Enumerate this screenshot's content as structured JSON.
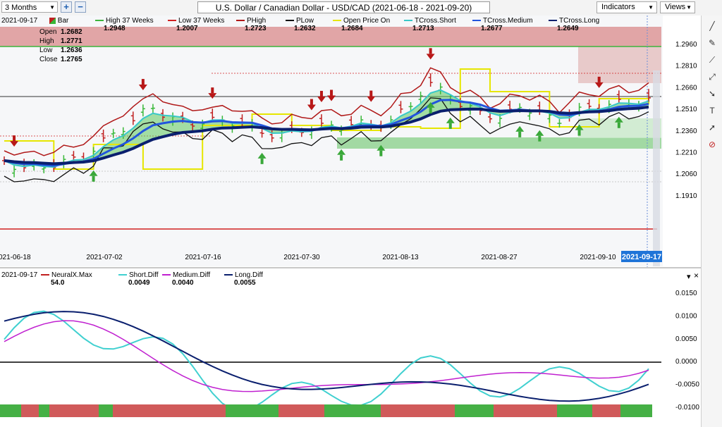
{
  "toolbar": {
    "period": "3 Months",
    "zoom_in": "+",
    "zoom_out": "−",
    "title": "U.S. Dollar / Canadian Dollar - USD/CAD (2021-06-18 - 2021-09-20)",
    "indicators_label": "Indicators",
    "views_label": "Views"
  },
  "price_legend": {
    "date": "2021-09-17",
    "bar_label": "Bar",
    "ohlc": [
      {
        "label": "Open",
        "value": "1.2682"
      },
      {
        "label": "High",
        "value": "1.2771"
      },
      {
        "label": "Low",
        "value": "1.2636"
      },
      {
        "label": "Close",
        "value": "1.2765"
      }
    ],
    "items": [
      {
        "label": "High 37 Weeks",
        "value": "1.2948",
        "color": "#3cb43c"
      },
      {
        "label": "Low 37 Weeks",
        "value": "1.2007",
        "color": "#d02020"
      },
      {
        "label": "PHigh",
        "value": "1.2723",
        "color": "#b01818"
      },
      {
        "label": "PLow",
        "value": "1.2632",
        "color": "#101010"
      },
      {
        "label": "Open Price On",
        "value": "1.2684",
        "color": "#e6e600"
      },
      {
        "label": "TCross.Short",
        "value": "1.2713",
        "color": "#38c8c8"
      },
      {
        "label": "TCross.Medium",
        "value": "1.2677",
        "color": "#2255dd"
      },
      {
        "label": "TCross.Long",
        "value": "1.2649",
        "color": "#0a1f6e"
      }
    ]
  },
  "price_axis": [
    "1.2960",
    "1.2810",
    "1.2660",
    "1.2510",
    "1.2360",
    "1.2210",
    "1.2060",
    "1.1910"
  ],
  "date_axis": [
    "2021-06-18",
    "2021-07-02",
    "2021-07-16",
    "2021-07-30",
    "2021-08-13",
    "2021-08-27",
    "2021-09-10"
  ],
  "current_date_badge": "2021-09-17",
  "indicator_legend": {
    "date": "2021-09-17",
    "items": [
      {
        "label": "NeuralX.Max",
        "value": "54.0",
        "color": "#c02020"
      },
      {
        "label": "Short.Diff",
        "value": "0.0049",
        "color": "#40d0d0"
      },
      {
        "label": "Medium.Diff",
        "value": "0.0040",
        "color": "#c020d0"
      },
      {
        "label": "Long.Diff",
        "value": "0.0055",
        "color": "#0a1f6e"
      }
    ]
  },
  "indicator_axis": [
    "0.0150",
    "0.0100",
    "0.0050",
    "0.0000",
    "-0.0050",
    "-0.0100"
  ],
  "colors": {
    "bull": "#38b838",
    "bear": "#c02020",
    "arrow_up": "#3aa83a",
    "arrow_down": "#b81818",
    "neutral_fill": "#5cc85c"
  }
}
